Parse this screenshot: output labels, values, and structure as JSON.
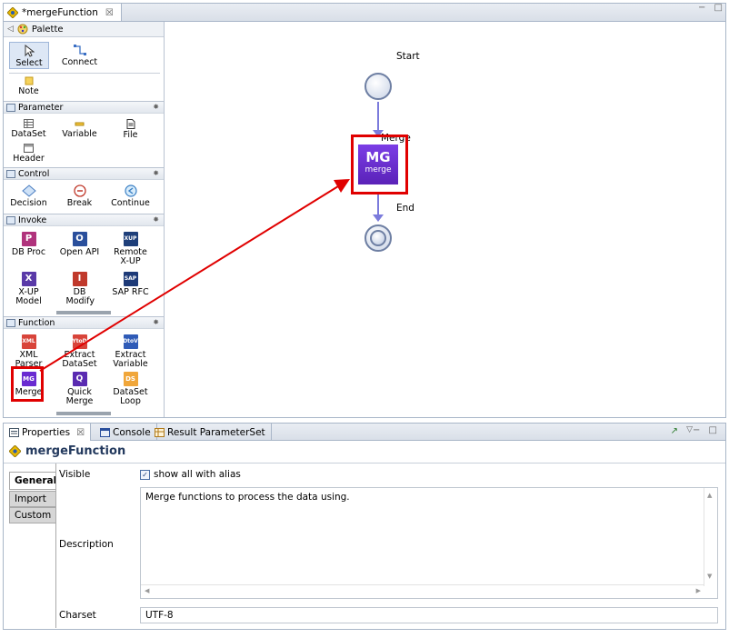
{
  "editor": {
    "tab_title": "*mergeFunction",
    "close_glyph": "☒",
    "window_buttons": "− □"
  },
  "palette": {
    "title": "Palette",
    "tools": {
      "select": "Select",
      "connect": "Connect",
      "note": "Note"
    },
    "drawers": {
      "parameter": {
        "title": "Parameter",
        "items": [
          "DataSet",
          "Variable",
          "File",
          "Header"
        ]
      },
      "control": {
        "title": "Control",
        "items": [
          "Decision",
          "Break",
          "Continue"
        ]
      },
      "invoke": {
        "title": "Invoke",
        "items": [
          "DB Proc",
          "Open API",
          "Remote X-UP",
          "X-UP Model",
          "DB Modify",
          "SAP RFC"
        ],
        "badges": [
          "P",
          "O",
          "XUP",
          "X",
          "I",
          "SAP"
        ]
      },
      "function": {
        "title": "Function",
        "items": [
          "XML Parser",
          "Extract DataSet",
          "Extract Variable",
          "Merge",
          "Quick Merge",
          "DataSet Loop"
        ],
        "badges": [
          "XML",
          "YtoD",
          "DtoV",
          "MG",
          "Q",
          "DS"
        ]
      }
    }
  },
  "canvas": {
    "start_label": "Start",
    "merge_label": "Merge",
    "end_label": "End",
    "merge_node": {
      "title": "MG",
      "subtitle": "merge"
    }
  },
  "properties": {
    "tabs": [
      "Properties",
      "Console",
      "Result ParameterSet"
    ],
    "header": "mergeFunction",
    "side_tabs": [
      "General",
      "Import",
      "Custom"
    ],
    "visible_label": "Visible",
    "visible_checkbox": "show all with alias",
    "description_label": "Description",
    "description_value": "Merge functions to process the data using.",
    "charset_label": "Charset",
    "charset_value": "UTF-8"
  },
  "colors": {
    "accent": "#6a2bd1",
    "highlight": "#e00000",
    "flow": "#7b7bdc"
  }
}
